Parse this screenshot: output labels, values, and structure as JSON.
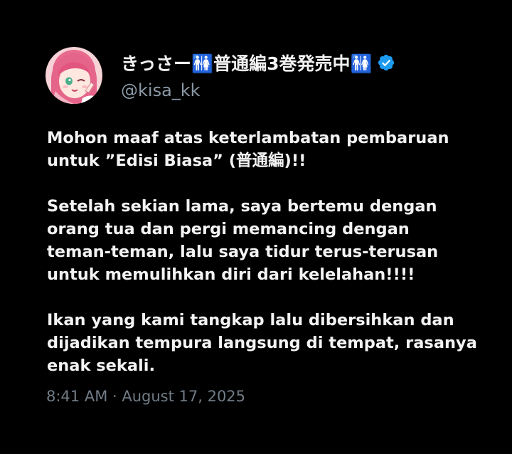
{
  "author": {
    "display_name": "きっさー🚻普通編3巻発売中🚻",
    "handle": "@kisa_kk",
    "verified_icon": "verified-badge-icon",
    "accent_color": "#1d9bf0"
  },
  "post": {
    "paragraphs": [
      {
        "lines": [
          "Mohon maaf atas keterlambatan pembaruan",
          "untuk ”Edisi Biasa” (普通編)!!"
        ]
      },
      {
        "lines": [
          "Setelah sekian lama, saya bertemu dengan",
          "orang tua dan pergi memancing dengan",
          "teman-teman, lalu saya tidur terus-terusan",
          "untuk memulihkan diri dari kelelahan!!!!"
        ]
      },
      {
        "lines": [
          "Ikan yang kami tangkap lalu dibersihkan dan",
          "dijadikan tempura langsung di tempat, rasanya",
          "enak sekali."
        ]
      }
    ],
    "timestamp": "8:41 AM · August 17, 2025"
  }
}
